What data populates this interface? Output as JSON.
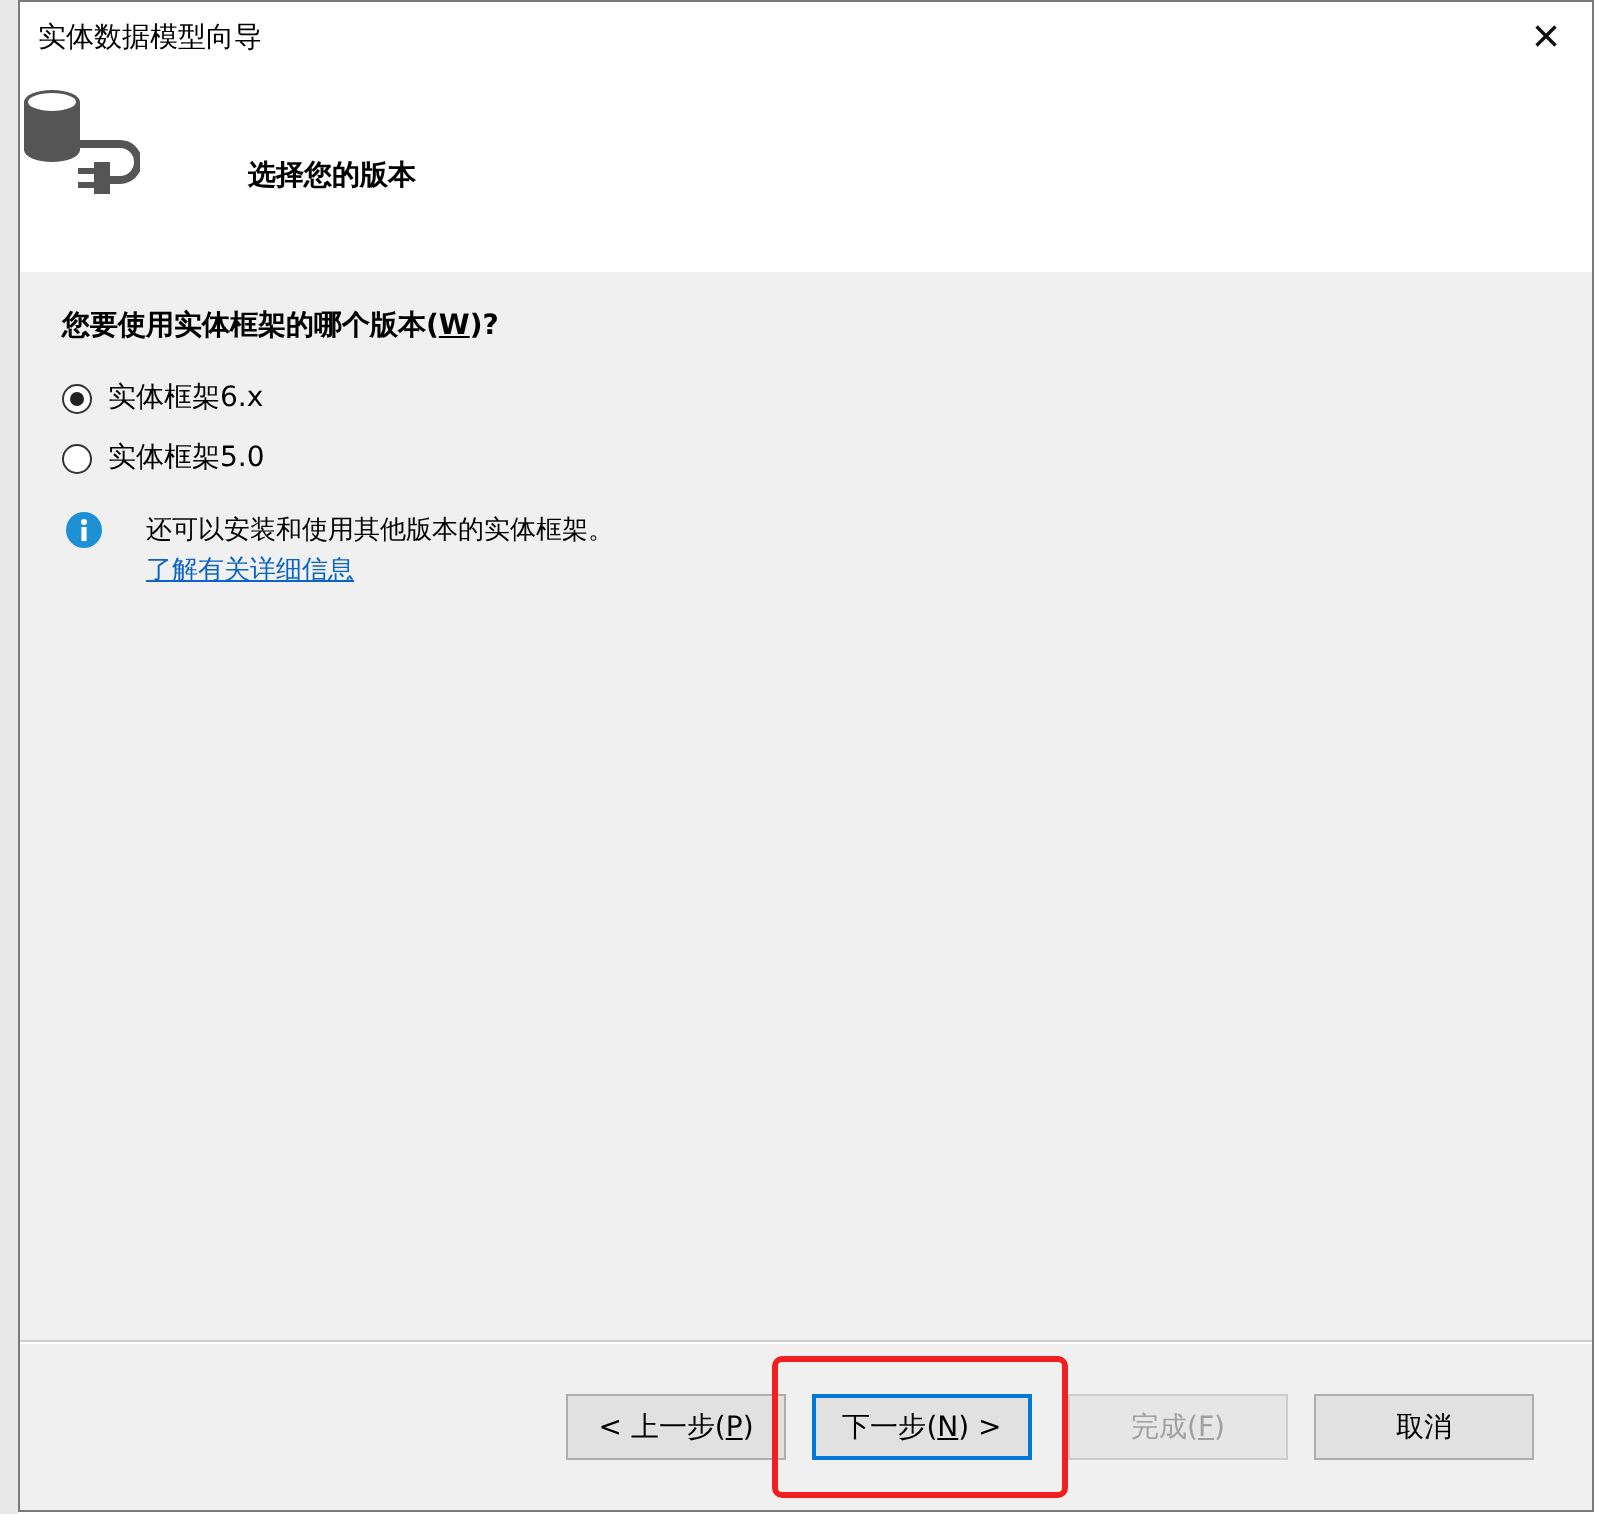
{
  "window": {
    "title": "实体数据模型向导",
    "close": "×"
  },
  "header": {
    "title": "选择您的版本"
  },
  "question": {
    "before": "您要使用实体框架的哪个版本(",
    "key": "W",
    "after": ")?"
  },
  "options": [
    {
      "label": "实体框架6.x",
      "selected": true
    },
    {
      "label": "实体框架5.0",
      "selected": false
    }
  ],
  "info": {
    "text": "还可以安装和使用其他版本的实体框架。",
    "link": "了解有关详细信息"
  },
  "buttons": [
    {
      "before": "< 上一步(",
      "key": "P",
      "after": ")",
      "disabled": false,
      "focused": false,
      "highlighted": false
    },
    {
      "before": "下一步(",
      "key": "N",
      "after": ") >",
      "disabled": false,
      "focused": true,
      "highlighted": true
    },
    {
      "before": "完成(",
      "key": "F",
      "after": ")",
      "disabled": true,
      "focused": false,
      "highlighted": false
    },
    {
      "before": "取消",
      "disabled": false,
      "focused": false,
      "highlighted": false
    }
  ]
}
